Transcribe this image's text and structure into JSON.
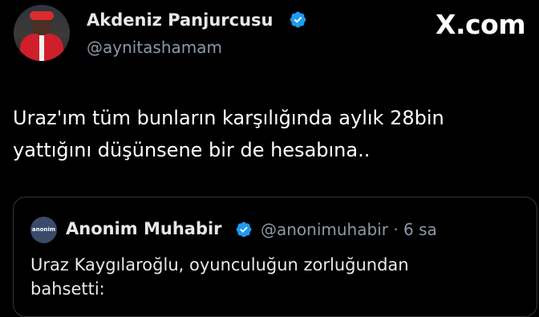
{
  "tweet": {
    "author_name": "Akdeniz Panjurcusu",
    "author_handle": "@aynitashamam",
    "text_line1": "Uraz'ım tüm bunların karşılığında aylık 28bin",
    "text_line2": "yattığını düşünsene bir de hesabına.."
  },
  "brand": {
    "label": "X.com"
  },
  "quoted_tweet": {
    "logo_text": "anonim",
    "author_name": "Anonim Muhabir",
    "author_handle": "@anonimuhabir",
    "separator": "·",
    "time": "6 sa",
    "text_line1": "Uraz Kaygılaroğlu, oyunculuğun zorluğundan",
    "text_line2": "bahsetti:"
  },
  "colors": {
    "background": "#000000",
    "verified": "#1d9bf0",
    "muted": "#8b98a5"
  },
  "icons": {
    "verified": "verified-badge-icon",
    "avatar": "user-avatar"
  }
}
